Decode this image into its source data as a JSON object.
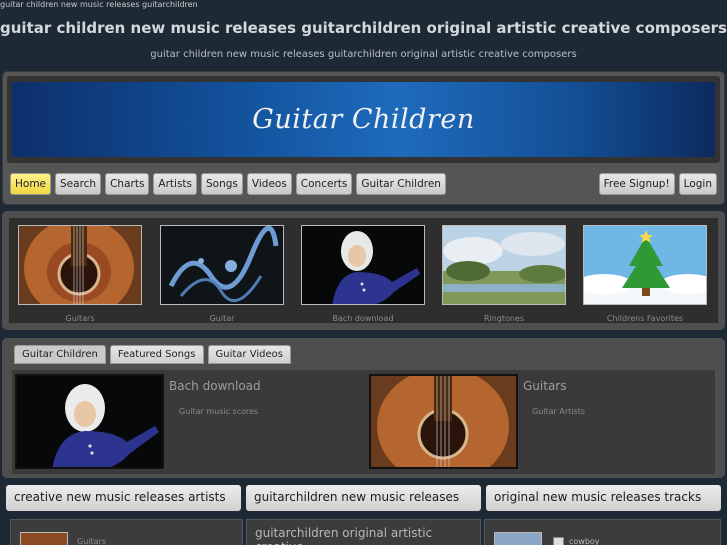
{
  "page": {
    "topline": "guitar children new music releases guitarchildren",
    "title": "guitar children new music releases guitarchildren original artistic creative composers",
    "subtitle": "guitar children new music releases guitarchildren original artistic creative composers"
  },
  "banner": {
    "text": "Guitar Children"
  },
  "nav": {
    "left": [
      "Home",
      "Search",
      "Charts",
      "Artists",
      "Songs",
      "Videos",
      "Concerts",
      "Guitar Children"
    ],
    "right": [
      "Free Signup!",
      "Login"
    ],
    "active": "Home"
  },
  "thumbs": [
    {
      "caption": "Guitars",
      "icon": "guitar-image"
    },
    {
      "caption": "Guitar",
      "icon": "splash-image"
    },
    {
      "caption": "Bach download",
      "icon": "bach-image"
    },
    {
      "caption": "Ringtones",
      "icon": "landscape-image"
    },
    {
      "caption": "Childrens Favorites",
      "icon": "christmas-tree-image"
    }
  ],
  "tabs": {
    "items": [
      "Guitar Children",
      "Featured Songs",
      "Guitar Videos"
    ],
    "active": "Guitar Children"
  },
  "featured": [
    {
      "title": "Bach download",
      "desc": "Guitar music scores"
    },
    {
      "title": "Guitars",
      "desc": "Guitar Artists"
    }
  ],
  "columns": [
    {
      "heading": "creative new music releases artists",
      "item": "Guitars"
    },
    {
      "heading": "guitarchildren new music releases",
      "item": "guitarchildren original artistic creative"
    },
    {
      "heading": "original new music releases tracks",
      "item": "cowboy"
    }
  ],
  "colors": {
    "background": "#1d2a36",
    "active_nav": "#f0d640",
    "banner": "#1355a0"
  }
}
